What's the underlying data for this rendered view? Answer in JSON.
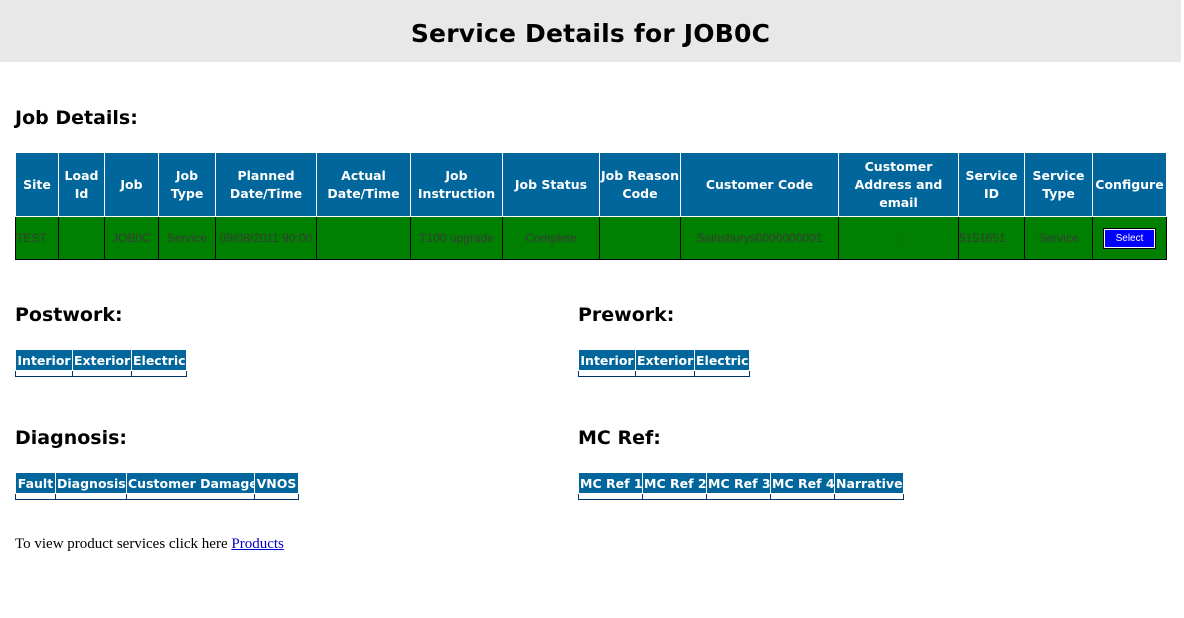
{
  "page": {
    "title": "Service Details for JOB0C"
  },
  "job_details": {
    "heading": "Job Details:",
    "columns": [
      "Site",
      "Load Id",
      "Job",
      "Job Type",
      "Planned Date/Time",
      "Actual Date/Time",
      "Job Instruction",
      "Job Status",
      "Job Reason Code",
      "Customer Code",
      "Customer Address and email",
      "Service ID",
      "Service Type",
      "Configure"
    ],
    "row": {
      "site": "TEST",
      "load_id": "",
      "job": "JOB0C",
      "job_type": "Service",
      "planned": "09/08/2011 90:00",
      "actual": "",
      "instruction": "T100 upgrade",
      "status": "Complete",
      "reason_code": "",
      "customer_code": "Sainsburys0000000001",
      "customer_address": ":",
      "service_id": "5151651",
      "service_type": "Service",
      "configure_button": "Select"
    }
  },
  "postwork": {
    "heading": "Postwork:",
    "columns": [
      "Interior",
      "Exterior",
      "Electric"
    ]
  },
  "prework": {
    "heading": "Prework:",
    "columns": [
      "Interior",
      "Exterior",
      "Electric"
    ]
  },
  "diagnosis": {
    "heading": "Diagnosis:",
    "columns": [
      "Fault",
      "Diagnosis",
      "Customer Damage",
      "VNOS"
    ]
  },
  "mc_ref": {
    "heading": "MC Ref:",
    "columns": [
      "MC Ref 1",
      "MC Ref 2",
      "MC Ref 3",
      "MC Ref 4",
      "Narrative"
    ]
  },
  "footer": {
    "text": "To view product services click here ",
    "link_label": "Products"
  },
  "colors": {
    "header_blue": "#00669b",
    "row_green": "#008000",
    "button_blue": "#0000ff",
    "title_bar": "#e8e8e8"
  }
}
